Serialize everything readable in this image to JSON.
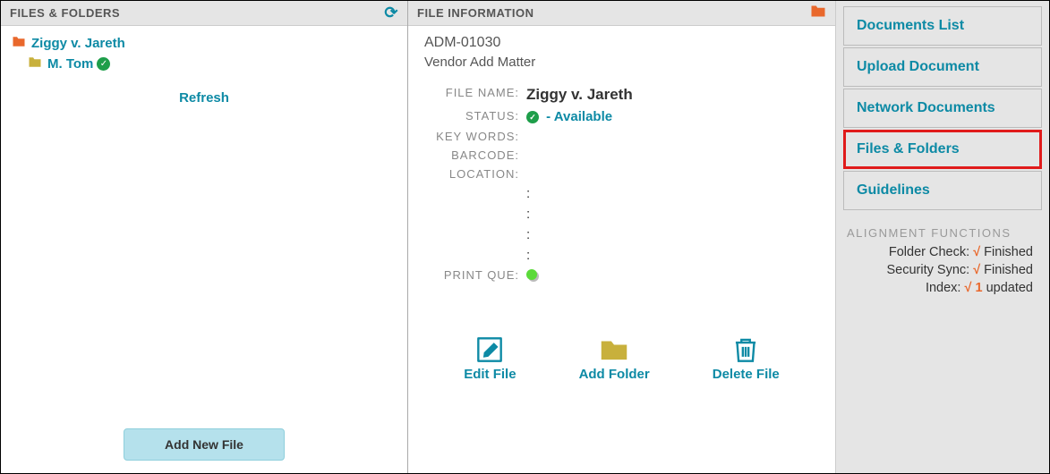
{
  "left": {
    "title": "FILES & FOLDERS",
    "tree": [
      {
        "icon_color": "#E9682C",
        "label": "Ziggy v. Jareth",
        "indent": 0,
        "checked": false
      },
      {
        "icon_color": "#C8B03C",
        "label": "M. Tom",
        "indent": 1,
        "checked": true
      }
    ],
    "refresh_label": "Refresh",
    "add_button": "Add New File"
  },
  "info": {
    "title": "FILE INFORMATION",
    "id": "ADM-01030",
    "subtitle": "Vendor Add Matter",
    "fields": {
      "file_name_k": "FILE NAME",
      "file_name_v": "Ziggy v. Jareth",
      "status_k": "STATUS",
      "status_v": "- Available",
      "keywords_k": "KEY WORDS",
      "keywords_v": "",
      "barcode_k": "BARCODE",
      "barcode_v": "",
      "location_k": "LOCATION",
      "location_v": "",
      "printque_k": "PRINT QUE",
      "printque_v": ""
    },
    "actions": {
      "edit": "Edit File",
      "add": "Add Folder",
      "delete": "Delete File"
    }
  },
  "right": {
    "nav": [
      "Documents List",
      "Upload Document",
      "Network Documents",
      "Files & Folders",
      "Guidelines"
    ],
    "active_index": 3,
    "alignment_header": "ALIGNMENT FUNCTIONS",
    "alignment": [
      {
        "label": "Folder Check:",
        "mark": "√",
        "value": "Finished"
      },
      {
        "label": "Security Sync:",
        "mark": "√",
        "value": "Finished"
      },
      {
        "label": "Index:",
        "mark": "√ 1",
        "value": "updated"
      }
    ]
  }
}
